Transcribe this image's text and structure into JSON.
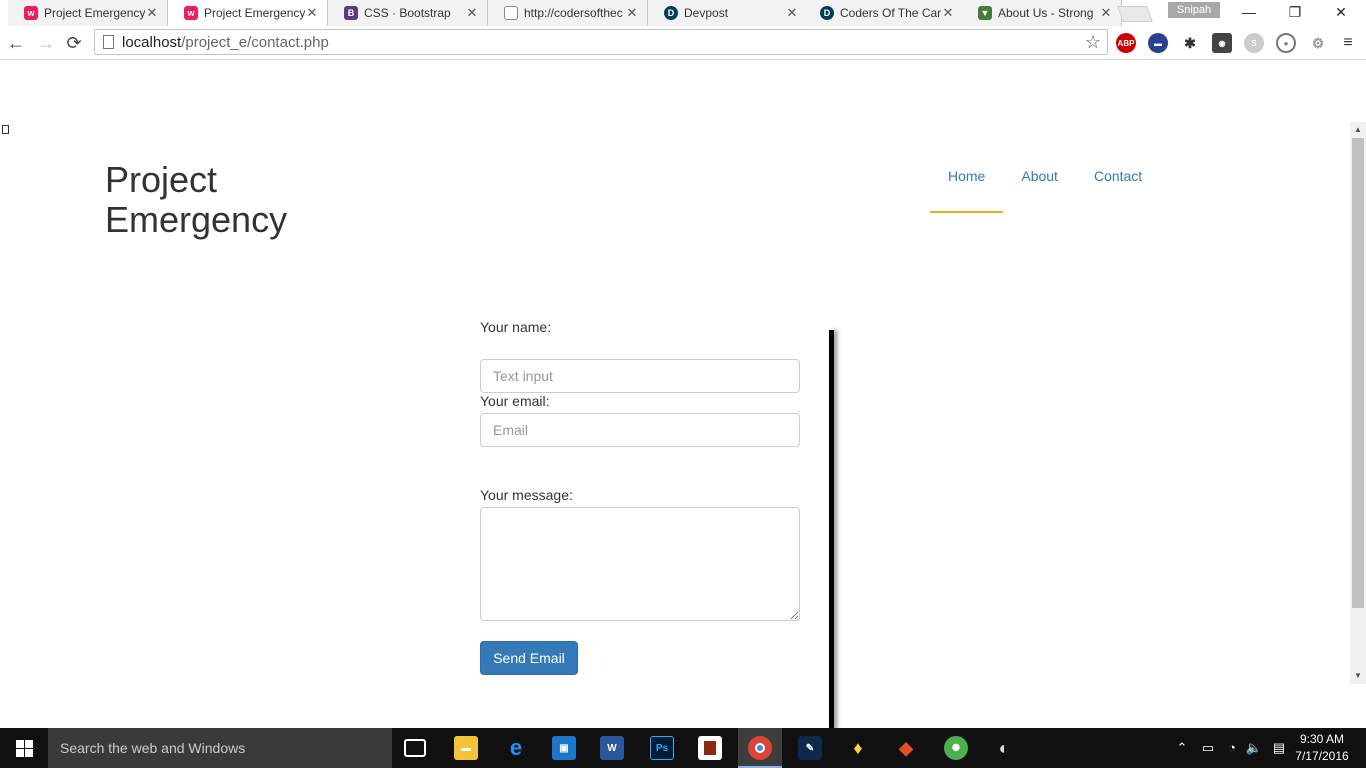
{
  "tabs": [
    {
      "title": "Project Emergency",
      "favicon": "wamp-icon",
      "color": "#e91e63",
      "active": false
    },
    {
      "title": "Project Emergency",
      "favicon": "wamp-icon",
      "color": "#e91e63",
      "active": true
    },
    {
      "title": "CSS · Bootstrap",
      "favicon": "bootstrap-icon",
      "color": "#563d7c",
      "active": false
    },
    {
      "title": "http://codersofthec",
      "favicon": "page-icon",
      "color": "#888888",
      "active": false
    },
    {
      "title": "Devpost",
      "favicon": "devpost-icon",
      "color": "#003e54",
      "active": false
    },
    {
      "title": "Coders Of The Cari",
      "favicon": "devpost-icon",
      "color": "#003e54",
      "active": false
    },
    {
      "title": "About Us - Strong",
      "favicon": "shield-icon",
      "color": "#4a7a3a",
      "active": false
    }
  ],
  "profile_name": "Snipah",
  "window_controls": {
    "minimize": "—",
    "restore": "❐",
    "close": "✕"
  },
  "omnibox": {
    "host": "localhost",
    "path": "/project_e/contact.php"
  },
  "extensions": [
    "ABP",
    "flag",
    "bug",
    "bulb",
    "S",
    "circle",
    "puzzle"
  ],
  "site": {
    "brand_line1": "Project",
    "brand_line2": "Emergency",
    "nav": [
      {
        "label": "Home",
        "active": true
      },
      {
        "label": "About",
        "active": false
      },
      {
        "label": "Contact",
        "active": false
      }
    ]
  },
  "form": {
    "name_label": "Your name:",
    "name_placeholder": "Text input",
    "email_label": "Your email:",
    "email_placeholder": "Email",
    "message_label": "Your message:",
    "send_label": "Send Email"
  },
  "taskbar": {
    "search_text": "Search the web and Windows",
    "time": "9:30 AM",
    "date": "7/17/2016"
  },
  "colors": {
    "link": "#337ab7",
    "nav_active_underline": "#f0ad1e",
    "button": "#337ab7"
  }
}
